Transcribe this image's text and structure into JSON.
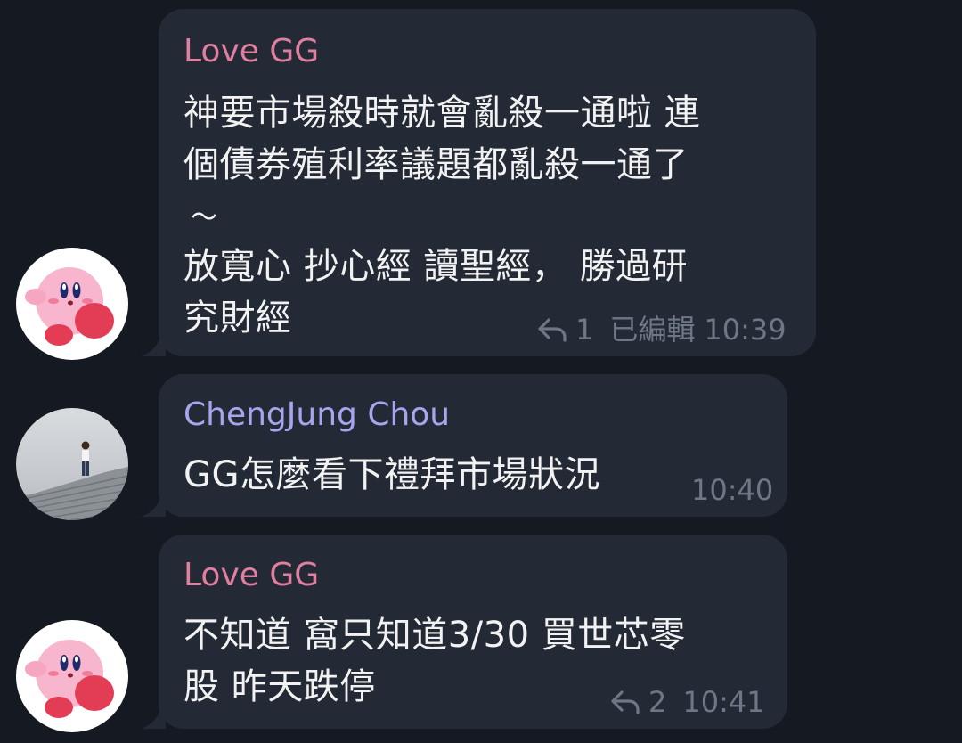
{
  "messages": [
    {
      "sender": "Love GG",
      "lines": [
        "神要市場殺時就會亂殺一通啦 連",
        "個債券殖利率議題都亂殺一通了",
        "～",
        "放寬心 抄心經 讀聖經， 勝過研",
        "究財經"
      ],
      "replies": "1",
      "edited": "已編輯",
      "time": "10:39"
    },
    {
      "sender": "ChengJung Chou",
      "lines": [
        "GG怎麼看下禮拜市場狀況"
      ],
      "time": "10:40"
    },
    {
      "sender": "Love GG",
      "lines": [
        "不知道 窩只知道3/30 買世芯零",
        "股 昨天跌停"
      ],
      "replies": "2",
      "time": "10:41"
    }
  ],
  "colors": {
    "background": "#151a22",
    "bubble": "#232a35",
    "sender_pink": "#e07fa0",
    "sender_purple": "#a5a6ee",
    "meta": "#6d7785"
  },
  "icons": [
    "kirby-avatar",
    "person-on-stairs-avatar",
    "reply-icon"
  ]
}
